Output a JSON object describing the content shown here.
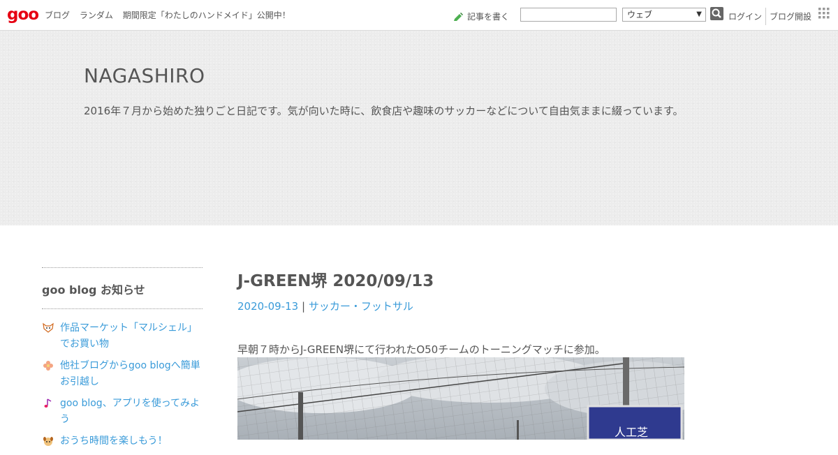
{
  "topbar": {
    "logo": "goo",
    "nav": [
      "ブログ",
      "ランダム",
      "期間限定「わたしのハンドメイド」公開中！"
    ],
    "write_label": "記事を書く",
    "search_value": "",
    "search_select": "ウェブ",
    "login": "ログイン",
    "open_blog": "ブログ開設"
  },
  "header": {
    "title": "NAGASHIRO",
    "description": "2016年７月から始めた独りごと日記です。気が向いた時に、飲食店や趣味のサッカーなどについて自由気ままに綴っています。"
  },
  "sidebar": {
    "title": "goo blog お知らせ",
    "items": [
      {
        "label": "作品マーケット「マルシェル」でお買い物",
        "icon": "fox-icon"
      },
      {
        "label": "他社ブログからgoo blogへ簡単お引越し",
        "icon": "flower-icon"
      },
      {
        "label": "goo blog、アプリを使ってみよう",
        "icon": "music-note-icon"
      },
      {
        "label": "おうち時間を楽しもう！",
        "icon": "dog-icon"
      }
    ]
  },
  "entry": {
    "title": "J-GREEN堺 2020/09/13",
    "date": "2020-09-13",
    "separator": "|",
    "category": "サッカー・フットサル",
    "text": "早朝７時からJ-GREEN堺にて行われたO50チームのトーニングマッチに参加。",
    "photo_sign": "人工芝"
  },
  "colors": {
    "logo": "#e60012",
    "link": "#3a9bd9",
    "text": "#555555",
    "header_bg": "#ececec"
  }
}
